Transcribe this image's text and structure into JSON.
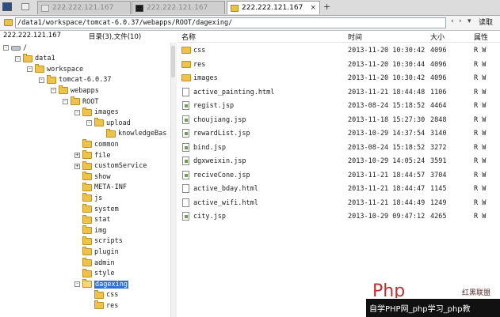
{
  "tabs": [
    {
      "label": "222.222.121.167",
      "icon": "monitor-icon",
      "active": false
    },
    {
      "label": "222.222.121.167",
      "icon": "terminal-icon",
      "active": false
    },
    {
      "label": "222.222.121.167",
      "icon": "folder-icon",
      "active": true,
      "close": "×"
    }
  ],
  "tab_add": "+",
  "pathbar": {
    "path": "/data1/workspace/tomcat-6.0.37/webapps/ROOT/dagexing/",
    "nav_prev": "‹",
    "nav_next": "›",
    "dropdown": "▾",
    "read_label": "读取"
  },
  "left_header": {
    "host": "222.222.121.167",
    "summary": "目录(3),文件(10)"
  },
  "columns": {
    "name": "名称",
    "time": "时间",
    "size": "大小",
    "attr": "属性"
  },
  "tree": [
    {
      "label": "/",
      "depth": 0,
      "exp": "-",
      "icon": "disk"
    },
    {
      "label": "data1",
      "depth": 1,
      "exp": "-",
      "icon": "folder"
    },
    {
      "label": "workspace",
      "depth": 2,
      "exp": "-",
      "icon": "folder"
    },
    {
      "label": "tomcat-6.0.37",
      "depth": 3,
      "exp": "-",
      "icon": "folder"
    },
    {
      "label": "webapps",
      "depth": 4,
      "exp": "-",
      "icon": "folder"
    },
    {
      "label": "ROOT",
      "depth": 5,
      "exp": "-",
      "icon": "folder"
    },
    {
      "label": "images",
      "depth": 6,
      "exp": "-",
      "icon": "folder"
    },
    {
      "label": "upload",
      "depth": 7,
      "exp": "-",
      "icon": "folder"
    },
    {
      "label": "knowledgeBas",
      "depth": 8,
      "exp": "",
      "icon": "folder"
    },
    {
      "label": "common",
      "depth": 6,
      "exp": "",
      "icon": "folder"
    },
    {
      "label": "file",
      "depth": 6,
      "exp": "+",
      "icon": "folder"
    },
    {
      "label": "customService",
      "depth": 6,
      "exp": "+",
      "icon": "folder"
    },
    {
      "label": "show",
      "depth": 6,
      "exp": "",
      "icon": "folder"
    },
    {
      "label": "META-INF",
      "depth": 6,
      "exp": "",
      "icon": "folder"
    },
    {
      "label": "js",
      "depth": 6,
      "exp": "",
      "icon": "folder"
    },
    {
      "label": "system",
      "depth": 6,
      "exp": "",
      "icon": "folder"
    },
    {
      "label": "stat",
      "depth": 6,
      "exp": "",
      "icon": "folder"
    },
    {
      "label": "img",
      "depth": 6,
      "exp": "",
      "icon": "folder"
    },
    {
      "label": "scripts",
      "depth": 6,
      "exp": "",
      "icon": "folder"
    },
    {
      "label": "plugin",
      "depth": 6,
      "exp": "",
      "icon": "folder"
    },
    {
      "label": "admin",
      "depth": 6,
      "exp": "",
      "icon": "folder"
    },
    {
      "label": "style",
      "depth": 6,
      "exp": "",
      "icon": "folder"
    },
    {
      "label": "dagexing",
      "depth": 6,
      "exp": "-",
      "icon": "folder",
      "selected": true
    },
    {
      "label": "css",
      "depth": 7,
      "exp": "",
      "icon": "folder"
    },
    {
      "label": "res",
      "depth": 7,
      "exp": "",
      "icon": "folder"
    }
  ],
  "files": [
    {
      "name": "css",
      "type": "folder",
      "time": "2013-11-20 10:30:42",
      "size": "4096",
      "attr": "R W"
    },
    {
      "name": "res",
      "type": "folder",
      "time": "2013-11-20 10:30:44",
      "size": "4096",
      "attr": "R W"
    },
    {
      "name": "images",
      "type": "folder",
      "time": "2013-11-20 10:30:42",
      "size": "4096",
      "attr": "R W"
    },
    {
      "name": "active_painting.html",
      "type": "doc",
      "time": "2013-11-21 18:44:48",
      "size": "1106",
      "attr": "R W"
    },
    {
      "name": "regist.jsp",
      "type": "edit",
      "time": "2013-08-24 15:18:52",
      "size": "4464",
      "attr": "R W"
    },
    {
      "name": "choujiang.jsp",
      "type": "edit",
      "time": "2013-11-18 15:27:30",
      "size": "2848",
      "attr": "R W"
    },
    {
      "name": "rewardList.jsp",
      "type": "edit",
      "time": "2013-10-29 14:37:54",
      "size": "3140",
      "attr": "R W"
    },
    {
      "name": "bind.jsp",
      "type": "edit",
      "time": "2013-08-24 15:18:52",
      "size": "3272",
      "attr": "R W"
    },
    {
      "name": "dgxweixin.jsp",
      "type": "edit",
      "time": "2013-10-29 14:05:24",
      "size": "3591",
      "attr": "R W"
    },
    {
      "name": "reciveCone.jsp",
      "type": "edit",
      "time": "2013-11-21 18:44:57",
      "size": "3704",
      "attr": "R W"
    },
    {
      "name": "active_bday.html",
      "type": "doc",
      "time": "2013-11-21 18:44:47",
      "size": "1145",
      "attr": "R W"
    },
    {
      "name": "active_wifi.html",
      "type": "doc",
      "time": "2013-11-21 18:44:49",
      "size": "1249",
      "attr": "R W"
    },
    {
      "name": "city.jsp",
      "type": "edit",
      "time": "2013-10-29 09:47:12",
      "size": "4265",
      "attr": "R W"
    }
  ],
  "watermark": {
    "text": "自学PHP网_php学习_php教",
    "logo_text": "Php",
    "side_text": "红黑联盟"
  },
  "colors": {
    "selection": "#2f6fd6",
    "folder": "#efc34a"
  }
}
